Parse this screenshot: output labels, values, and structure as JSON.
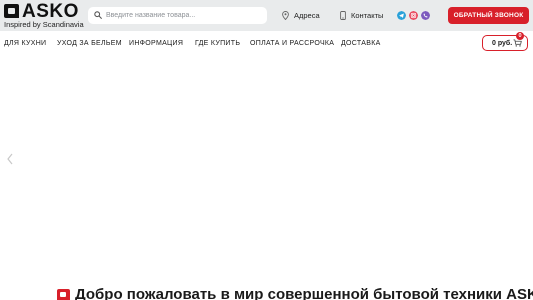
{
  "brand": {
    "name": "ASKO",
    "tagline": "Inspired by Scandinavia"
  },
  "search": {
    "placeholder": "Введите название товара..."
  },
  "header": {
    "addresses_label": "Адреса",
    "contacts_label": "Контакты",
    "callback_label": "ОБРАТНЫЙ ЗВОНОК",
    "social_icons": [
      "telegram-icon",
      "instagram-icon",
      "viber-icon"
    ]
  },
  "nav": {
    "items": [
      {
        "label": "ДЛЯ КУХНИ"
      },
      {
        "label": "УХОД ЗА БЕЛЬЕМ"
      },
      {
        "label": "ИНФОРМАЦИЯ"
      },
      {
        "label": "ГДЕ КУПИТЬ"
      },
      {
        "label": "ОПЛАТА И РАССРОЧКА"
      },
      {
        "label": "ДОСТАВКА"
      }
    ]
  },
  "cart": {
    "total": "0 руб.",
    "count": "0"
  },
  "welcome": {
    "title": "Добро пожаловать в мир совершенной бытовой техники ASKO!"
  },
  "colors": {
    "accent": "#d8202a",
    "topbar_bg": "#e9ebec",
    "telegram": "#2aa1d9",
    "instagram": "#e8445a",
    "viber": "#7d5bbe"
  }
}
